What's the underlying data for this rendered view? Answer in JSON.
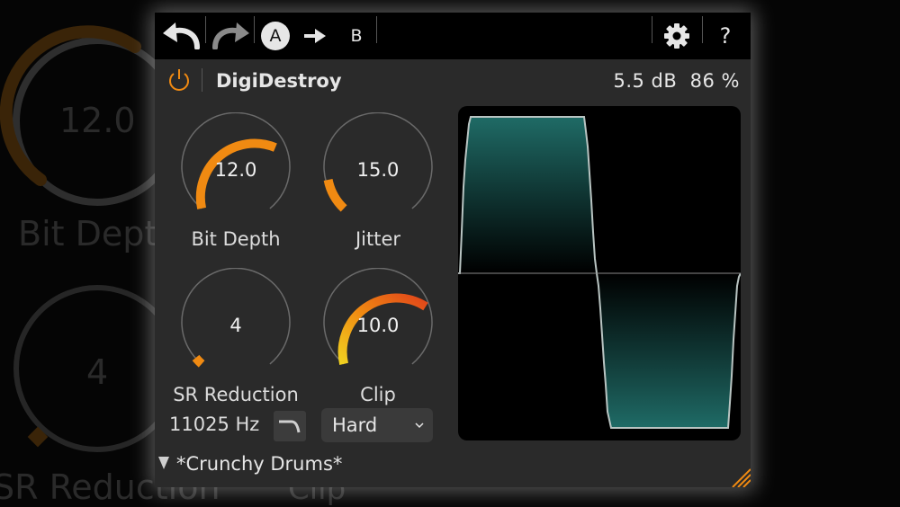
{
  "toolbar": {
    "undo_icon": "undo-icon",
    "redo_icon": "redo-icon",
    "slot_a": "A",
    "slot_b": "B",
    "copy_icon": "arrow-right-icon",
    "settings_icon": "gear-icon",
    "help": "?"
  },
  "header": {
    "title": "DigiDestroy",
    "level": "5.5 dB",
    "mix": "86 %"
  },
  "knobs": {
    "bit_depth": {
      "label": "Bit Depth",
      "value": "12.0"
    },
    "jitter": {
      "label": "Jitter",
      "value": "15.0"
    },
    "sr_reduction": {
      "label": "SR Reduction",
      "value": "4"
    },
    "clip": {
      "label": "Clip",
      "value": "10.0"
    }
  },
  "sr_frequency": "11025 Hz",
  "clip_mode": {
    "selected": "Hard"
  },
  "preset": {
    "name": "*Crunchy Drums*"
  },
  "background": {
    "knob_value": "12.0",
    "label_bit": "Bit Depth",
    "knob_value2": "4",
    "label_sr": "SR Reduction",
    "label_clip": "Clip"
  },
  "colors": {
    "accent_orange": "#f08a12",
    "accent_red": "#e0451a",
    "accent_yellow": "#f0d020",
    "scope_fill": "#1f6b66",
    "panel": "#2a2a2a"
  }
}
